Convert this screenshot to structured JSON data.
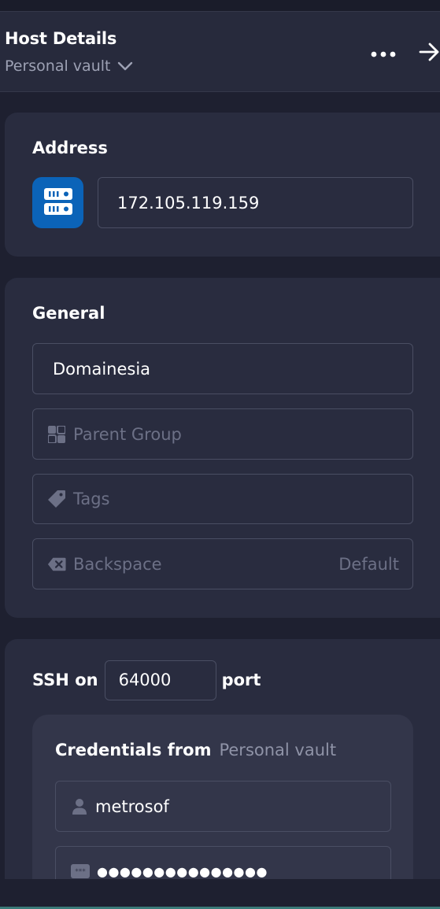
{
  "header": {
    "title": "Host Details",
    "vault": "Personal vault",
    "more_icon": "more-horizontal-icon",
    "forward_icon": "arrow-right-icon"
  },
  "address": {
    "heading": "Address",
    "icon": "server-icon",
    "icon_color": "#0b63b8",
    "value": "172.105.119.159"
  },
  "general": {
    "heading": "General",
    "label_value": "Domainesia",
    "parent_group_placeholder": "Parent Group",
    "tags_placeholder": "Tags",
    "backspace_label": "Backspace",
    "backspace_value": "Default"
  },
  "ssh": {
    "prefix": "SSH on",
    "port": "64000",
    "suffix": "port",
    "credentials_label": "Credentials from",
    "credentials_source": "Personal vault",
    "username": "metrosof",
    "password_mask": "●●●●●●●●●●●●●●●"
  },
  "colors": {
    "background": "#1e2030",
    "card": "#292c3f",
    "accent": "#0b63b8"
  }
}
